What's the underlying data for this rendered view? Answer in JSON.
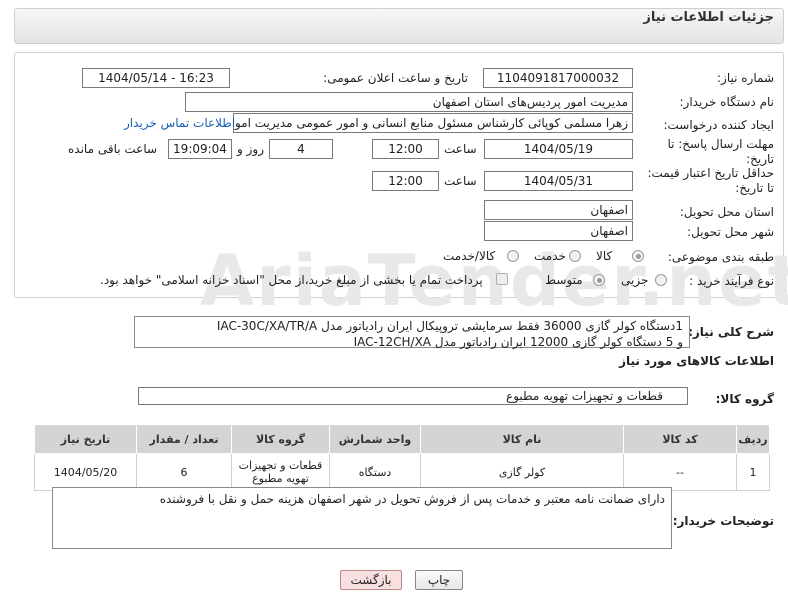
{
  "panel": {
    "title": "جزئیات اطلاعات نیاز"
  },
  "watermark": "AriaTender.net",
  "fields": {
    "need_number_label": "شماره نیاز:",
    "need_number": "1104091817000032",
    "announce_label": "تاریخ و ساعت اعلان عمومی:",
    "announce_value": "1404/05/14 - 16:23",
    "buyer_org_label": "نام دستگاه خریدار:",
    "buyer_org": "مدیریت امور پردیس‌های استان اصفهان",
    "creator_label": "ایجاد کننده درخواست:",
    "creator": "زهرا مسلمی کوپائی کارشناس مسئول منابع انسانی و امور عمومی مدیریت امو",
    "contact_link": "اطلاعات تماس خریدار",
    "reply_deadline_label": "مهلت ارسال پاسخ: تا تاریخ:",
    "reply_date": "1404/05/19",
    "time_label": "ساعت",
    "reply_time": "12:00",
    "days_value": "4",
    "days_label": "روز و",
    "remaining_time": "19:09:04",
    "remaining_label": "ساعت باقی مانده",
    "price_validity_label": "حداقل تاریخ اعتبار قیمت: تا تاریخ:",
    "validity_date": "1404/05/31",
    "validity_time": "12:00",
    "delivery_province_label": "استان محل تحویل:",
    "delivery_province": "اصفهان",
    "delivery_city_label": "شهر محل تحویل:",
    "delivery_city": "اصفهان",
    "category_label": "طبقه بندی موضوعی:",
    "category_options": [
      "کالا",
      "خدمت",
      "کالا/خدمت"
    ],
    "process_label": "نوع فرآیند خرید :",
    "process_options": [
      "جزیی",
      "متوسط"
    ],
    "payment_note": "پرداخت تمام یا بخشی از مبلغ خرید،از محل \"اسناد خزانه اسلامی\" خواهد بود."
  },
  "description": {
    "label": "شرح کلی نیاز:",
    "line1": "1دستگاه کولر گازی 36000 فقط سرمایشی تروپیکال ایران رادیاتور مدل IAC-30C/XA/TR/A",
    "line2": "و 5 دستگاه کولر گازی 12000 ایران رادیاتور  مدل IAC-12CH/XA"
  },
  "goods_section": {
    "title": "اطلاعات کالاهای مورد نیاز",
    "group_label": "گروه کالا:",
    "group_value": "قطعات و تجهیزات تهویه مطبوع"
  },
  "table": {
    "headers": [
      "ردیف",
      "کد کالا",
      "نام کالا",
      "واحد شمارش",
      "گروه کالا",
      "تعداد / مقدار",
      "تاریخ نیاز"
    ],
    "rows": [
      [
        "1",
        "--",
        "کولر گازی",
        "دستگاه",
        "قطعات و تجهیزات تهویه مطبوع",
        "6",
        "1404/05/20"
      ]
    ]
  },
  "buyer_notes": {
    "label": "توضیحات خریدار:",
    "text": "دارای ضمانت نامه معتبر و خدمات پس از فروش تحویل در شهر اصفهان هزینه حمل و نقل با فروشنده"
  },
  "buttons": {
    "print": "چاپ",
    "back": "بازگشت"
  }
}
